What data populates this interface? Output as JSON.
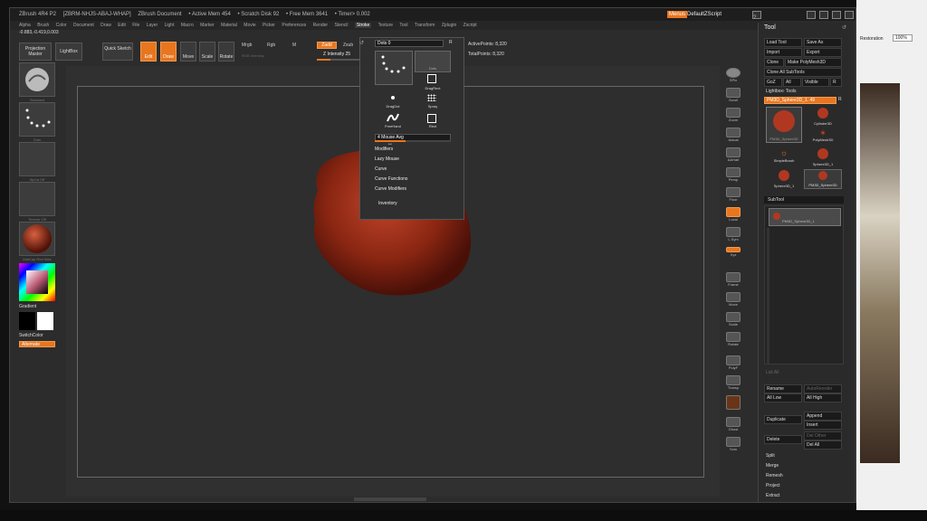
{
  "titlebar": {
    "items": [
      "ZBrush 4R4 P2",
      "[ZBRM-NHJS-ABAJ-WHAP]",
      "ZBrush Document",
      "• Active Mem 454",
      "• Scratch Disk 92",
      "• Free Mem 3641",
      "• Timer> 0.002"
    ],
    "menus_btn": "Menus",
    "script_label": "DefaultZScript"
  },
  "menubar": [
    "Alpha",
    "Brush",
    "Color",
    "Document",
    "Draw",
    "Edit",
    "File",
    "Layer",
    "Light",
    "Macro",
    "Marker",
    "Material",
    "Movie",
    "Picker",
    "Preferences",
    "Render",
    "Stencil",
    "Stroke",
    "Texture",
    "Tool",
    "Transform",
    "Zplugin",
    "Zscript"
  ],
  "menubar_active": "Stroke",
  "coords": "-0.883,-0.419,0.003",
  "shelf": {
    "projection_master": "Projection Master",
    "lightbox": "LightBox",
    "quick_sketch": "Quick Sketch",
    "edit": "Edit",
    "draw": "Draw",
    "move": "Move",
    "scale": "Scale",
    "rotate": "Rotate",
    "mrgb": "Mrgb",
    "rgb": "Rgb",
    "m": "M",
    "rgb_intensity": "RGB Intensity",
    "zadd": "Zadd",
    "zsub": "Zsub",
    "z_intensity": "Z Intensity 25",
    "active_points": "ActivePoints: 8,320",
    "total_points": "TotalPoints: 8,320"
  },
  "left_tiles": [
    {
      "label": "Standard"
    },
    {
      "label": "Dots"
    },
    {
      "label": "Alpha Off"
    },
    {
      "label": "Texture Off"
    },
    {
      "label": "MatCap Red Wax"
    }
  ],
  "left": {
    "gradient": "Gradient",
    "switch_color": "SwitchColor",
    "alternate": "Alternate"
  },
  "stroke_popup": {
    "dots_label": "Dots",
    "dots_value": "0",
    "r": "R",
    "strokes": [
      "Dots",
      "DragRect",
      "DragDot",
      "Spray",
      "FreeHand",
      "Rect"
    ],
    "mouse_avg": "4 Mouse Avg",
    "menu": [
      "Modifiers",
      "Lazy Mouse",
      "Curve",
      "Curve Functions",
      "Curve Modifiers"
    ],
    "inventory": "Inventory"
  },
  "right_shelf": [
    "SPix",
    "Scroll",
    "Zoom",
    "Actual",
    "AAHalf",
    "Persp",
    "Floor",
    "Local",
    "L.Sym",
    "Xyz",
    "",
    "Frame",
    "Move",
    "Scale",
    "Rotate",
    "PolyF",
    "Transp",
    "",
    "Ghost",
    "Solo"
  ],
  "tool": {
    "title": "Tool",
    "load": "Load Tool",
    "save": "Save As",
    "import": "Import",
    "export": "Export",
    "clone": "Clone",
    "make": "Make PolyMesh3D",
    "clone_all": "Clone All SubTools",
    "goz": "GoZ",
    "all": "All",
    "visible": "Visible",
    "r": "R",
    "lightbox_tools": "Lightbox› Tools",
    "current": "PM3D_Sphere3D_1. 49",
    "thumbs": [
      "PM3D_Sphere3D",
      "Cylinder3D",
      "PolyMesh3D",
      "SimpleBrush",
      "Sphere3D_1",
      "PM3D_Sphere3D"
    ],
    "subtool": "SubTool",
    "subtool_item": "PM3D_Sphere3D_1",
    "list_all": "List All",
    "rename": "Rename",
    "auto_reorder": "AutoReorder",
    "all_low": "All Low",
    "all_high": "All High",
    "duplicate": "Duplicate",
    "append": "Append",
    "insert": "Insert",
    "delete": "Delete",
    "del_other": "Del Other",
    "del_all": "Del All",
    "split": "Split",
    "merge": "Merge",
    "remesh": "Remesh",
    "project": "Project",
    "extract": "Extract"
  },
  "browser": {
    "restoration": "Restoration",
    "zoom": "100%"
  },
  "colors": {
    "accent": "#e8761f",
    "bg": "#2c2c2c",
    "mesh": "#a02c14"
  }
}
